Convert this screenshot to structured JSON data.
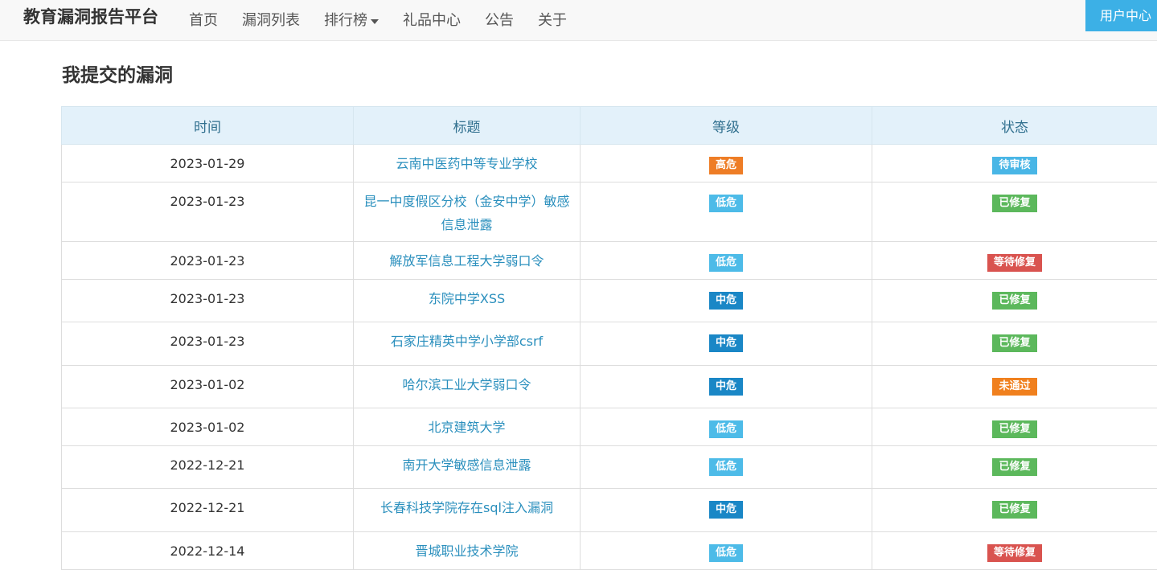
{
  "navbar": {
    "brand": "教育漏洞报告平台",
    "items": [
      {
        "label": "首页",
        "dropdown": false
      },
      {
        "label": "漏洞列表",
        "dropdown": false
      },
      {
        "label": "排行榜",
        "dropdown": true
      },
      {
        "label": "礼品中心",
        "dropdown": false
      },
      {
        "label": "公告",
        "dropdown": false
      },
      {
        "label": "关于",
        "dropdown": false
      }
    ],
    "user_center": "用户中心"
  },
  "main": {
    "page_title": "我提交的漏洞",
    "table": {
      "columns": [
        "时间",
        "标题",
        "等级",
        "状态"
      ],
      "rows": [
        {
          "date": "2023-01-29",
          "title": "云南中医药中等专业学校",
          "level": "高危",
          "status": "待审核"
        },
        {
          "date": "2023-01-23",
          "title": "昆一中度假区分校（金安中学）敏感信息泄露",
          "level": "低危",
          "status": "已修复"
        },
        {
          "date": "2023-01-23",
          "title": "解放军信息工程大学弱口令",
          "level": "低危",
          "status": "等待修复"
        },
        {
          "date": "2023-01-23",
          "title": "东院中学XSS",
          "level": "中危",
          "status": "已修复"
        },
        {
          "date": "2023-01-23",
          "title": "石家庄精英中学小学部csrf",
          "level": "中危",
          "status": "已修复"
        },
        {
          "date": "2023-01-02",
          "title": "哈尔滨工业大学弱口令",
          "level": "中危",
          "status": "未通过"
        },
        {
          "date": "2023-01-02",
          "title": "北京建筑大学",
          "level": "低危",
          "status": "已修复"
        },
        {
          "date": "2022-12-21",
          "title": "南开大学敏感信息泄露",
          "level": "低危",
          "status": "已修复"
        },
        {
          "date": "2022-12-21",
          "title": "长春科技学院存在sql注入漏洞",
          "level": "中危",
          "status": "已修复"
        },
        {
          "date": "2022-12-14",
          "title": "晋城职业技术学院",
          "level": "低危",
          "status": "等待修复"
        }
      ]
    }
  },
  "colors": {
    "level": {
      "高危": "#ee7d26",
      "中危": "#1a87c6",
      "低危": "#4dbbe8"
    },
    "status": {
      "待审核": "#49b6e6",
      "已修复": "#5cb85c",
      "等待修复": "#d9534f",
      "未通过": "#f0801e"
    }
  }
}
